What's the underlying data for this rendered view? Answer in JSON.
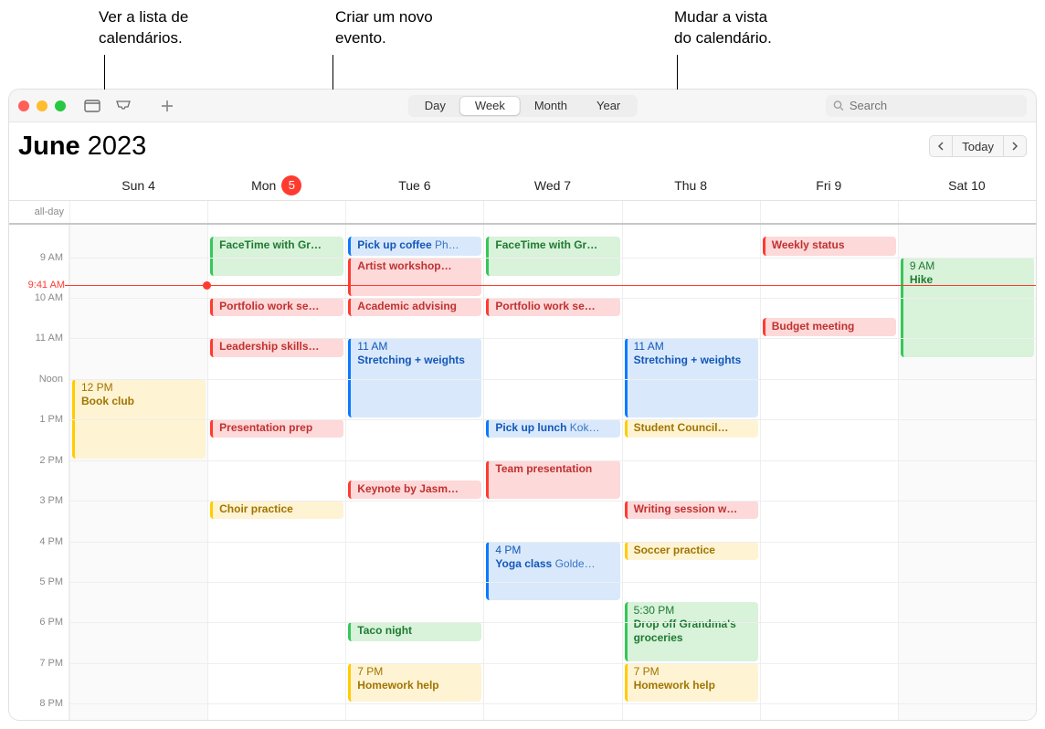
{
  "callouts": {
    "list": "Ver a lista de\ncalendários.",
    "create": "Criar um novo\nevento.",
    "view": "Mudar a vista\ndo calendário."
  },
  "toolbar": {
    "views": {
      "day": "Day",
      "week": "Week",
      "month": "Month",
      "year": "Year"
    },
    "selected_view": "week",
    "search_placeholder": "Search"
  },
  "header": {
    "month": "June",
    "year": "2023",
    "today": "Today"
  },
  "allday_label": "all-day",
  "now_time": "9:41 AM",
  "days": [
    {
      "label": "Sun",
      "num": "4",
      "today": false,
      "weekend": true
    },
    {
      "label": "Mon",
      "num": "5",
      "today": true,
      "weekend": false
    },
    {
      "label": "Tue",
      "num": "6",
      "today": false,
      "weekend": false
    },
    {
      "label": "Wed",
      "num": "7",
      "today": false,
      "weekend": false
    },
    {
      "label": "Thu",
      "num": "8",
      "today": false,
      "weekend": false
    },
    {
      "label": "Fri",
      "num": "9",
      "today": false,
      "weekend": false
    },
    {
      "label": "Sat",
      "num": "10",
      "today": false,
      "weekend": true
    }
  ],
  "time_labels": [
    {
      "t": "9 AM",
      "h": 9
    },
    {
      "t": "10 AM",
      "h": 10
    },
    {
      "t": "11 AM",
      "h": 11
    },
    {
      "t": "Noon",
      "h": 12
    },
    {
      "t": "1 PM",
      "h": 13
    },
    {
      "t": "2 PM",
      "h": 14
    },
    {
      "t": "3 PM",
      "h": 15
    },
    {
      "t": "4 PM",
      "h": 16
    },
    {
      "t": "5 PM",
      "h": 17
    },
    {
      "t": "6 PM",
      "h": 18
    },
    {
      "t": "7 PM",
      "h": 19
    },
    {
      "t": "8 PM",
      "h": 20
    }
  ],
  "start_hour": 8.2,
  "end_hour": 20.4,
  "now_hour": 9.68,
  "events": [
    {
      "day": 0,
      "start": 12.0,
      "end": 14.0,
      "color": "yellow",
      "time": "12 PM",
      "title": "Book club"
    },
    {
      "day": 1,
      "start": 8.5,
      "end": 9.5,
      "color": "green",
      "title": "FaceTime with Gr…"
    },
    {
      "day": 1,
      "start": 10.0,
      "end": 10.5,
      "color": "red",
      "title": "Portfolio work se…"
    },
    {
      "day": 1,
      "start": 11.0,
      "end": 11.5,
      "color": "red",
      "title": "Leadership skills…"
    },
    {
      "day": 1,
      "start": 13.0,
      "end": 13.5,
      "color": "red",
      "title": "Presentation prep"
    },
    {
      "day": 1,
      "start": 15.0,
      "end": 15.5,
      "color": "yellow",
      "title": "Choir practice"
    },
    {
      "day": 2,
      "start": 8.5,
      "end": 9.0,
      "color": "blue",
      "title": "Pick up coffee",
      "loc": "Ph…"
    },
    {
      "day": 2,
      "start": 9.0,
      "end": 10.0,
      "color": "red",
      "title": "Artist workshop…"
    },
    {
      "day": 2,
      "start": 10.0,
      "end": 10.5,
      "color": "red",
      "title": "Academic advising"
    },
    {
      "day": 2,
      "start": 11.0,
      "end": 13.0,
      "color": "blue",
      "time": "11 AM",
      "title": "Stretching + weights"
    },
    {
      "day": 2,
      "start": 14.5,
      "end": 15.0,
      "color": "red",
      "title": "Keynote by Jasm…"
    },
    {
      "day": 2,
      "start": 18.0,
      "end": 18.5,
      "color": "green",
      "title": "Taco night"
    },
    {
      "day": 2,
      "start": 19.0,
      "end": 20.0,
      "color": "yellow",
      "time": "7 PM",
      "title": "Homework help"
    },
    {
      "day": 3,
      "start": 8.5,
      "end": 9.5,
      "color": "green",
      "title": "FaceTime with Gr…"
    },
    {
      "day": 3,
      "start": 10.0,
      "end": 10.5,
      "color": "red",
      "title": "Portfolio work se…"
    },
    {
      "day": 3,
      "start": 13.0,
      "end": 13.5,
      "color": "blue",
      "title": "Pick up lunch",
      "loc": "Kok…"
    },
    {
      "day": 3,
      "start": 14.0,
      "end": 15.0,
      "color": "red",
      "title": "Team presentation"
    },
    {
      "day": 3,
      "start": 16.0,
      "end": 17.5,
      "color": "blue",
      "time": "4 PM",
      "title": "Yoga class",
      "loc": "Golde…"
    },
    {
      "day": 4,
      "start": 11.0,
      "end": 13.0,
      "color": "blue",
      "time": "11 AM",
      "title": "Stretching + weights"
    },
    {
      "day": 4,
      "start": 13.0,
      "end": 13.5,
      "color": "yellow",
      "title": "Student Council…"
    },
    {
      "day": 4,
      "start": 15.0,
      "end": 15.5,
      "color": "red",
      "title": "Writing session w…"
    },
    {
      "day": 4,
      "start": 16.0,
      "end": 16.5,
      "color": "yellow",
      "title": "Soccer practice"
    },
    {
      "day": 4,
      "start": 17.5,
      "end": 19.0,
      "color": "green",
      "time": "5:30 PM",
      "title": "Drop off Grandma's groceries"
    },
    {
      "day": 4,
      "start": 19.0,
      "end": 20.0,
      "color": "yellow",
      "time": "7 PM",
      "title": "Homework help"
    },
    {
      "day": 5,
      "start": 8.5,
      "end": 9.0,
      "color": "red",
      "title": "Weekly status"
    },
    {
      "day": 5,
      "start": 10.5,
      "end": 11.0,
      "color": "red",
      "title": "Budget meeting"
    },
    {
      "day": 6,
      "start": 9.0,
      "end": 11.5,
      "color": "green",
      "time": "9 AM",
      "title": "Hike"
    }
  ]
}
